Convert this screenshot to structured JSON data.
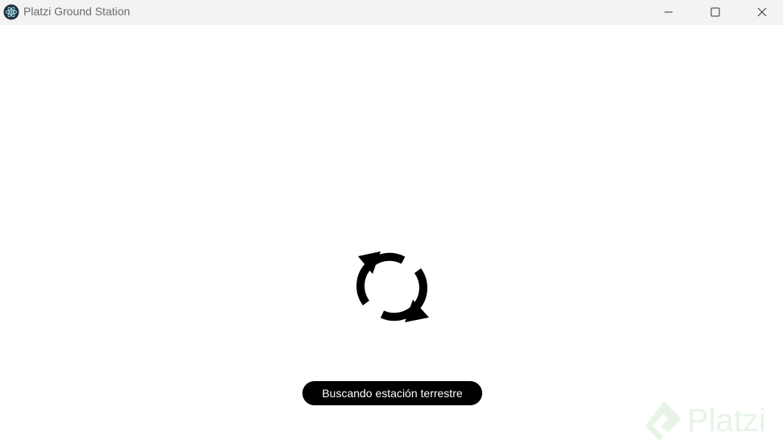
{
  "window": {
    "title": "Platzi Ground Station",
    "app_icon": "electron-atom-icon",
    "controls": {
      "minimize_icon": "minimize-icon",
      "maximize_icon": "maximize-icon",
      "close_icon": "close-icon"
    }
  },
  "main": {
    "spinner_icon": "refresh-icon",
    "status_text": "Buscando estación terrestre"
  },
  "watermark": {
    "text": "Platzi",
    "logo_icon": "platzi-logo-icon"
  },
  "colors": {
    "titlebar_bg": "#f3f3f3",
    "status_pill_bg": "#000000",
    "status_pill_text": "#ffffff",
    "watermark_green": "#4caf50"
  }
}
